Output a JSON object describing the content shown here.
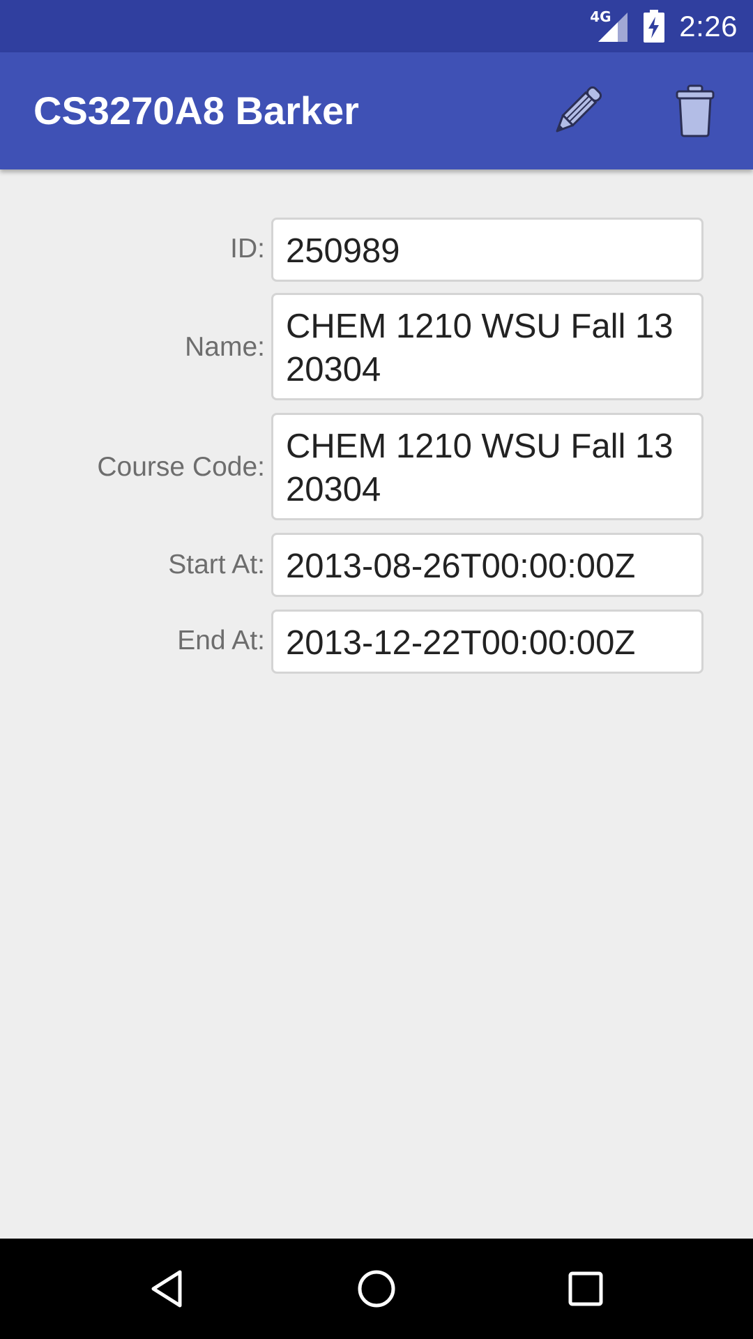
{
  "status_bar": {
    "network_label": "4G",
    "time": "2:26",
    "icons": [
      "signal-icon",
      "battery-charging-icon"
    ]
  },
  "app_bar": {
    "title": "CS3270A8 Barker",
    "actions": [
      {
        "name": "edit",
        "icon": "pencil-icon"
      },
      {
        "name": "delete",
        "icon": "trash-icon"
      }
    ]
  },
  "form": {
    "id": {
      "label": "ID:",
      "value": "250989"
    },
    "name": {
      "label": "Name:",
      "value": "CHEM 1210 WSU Fall 13 20304"
    },
    "course_code": {
      "label": "Course Code:",
      "value": "CHEM 1210 WSU Fall 13 20304"
    },
    "start_at": {
      "label": "Start At:",
      "value": "2013-08-26T00:00:00Z"
    },
    "end_at": {
      "label": "End At:",
      "value": "2013-12-22T00:00:00Z"
    }
  },
  "nav_bar": {
    "buttons": [
      "back-icon",
      "home-icon",
      "recents-icon"
    ]
  },
  "colors": {
    "status_bar": "#303f9f",
    "app_bar": "#3f51b5",
    "background": "#eeeeee",
    "icon_fill": "#b3bde6"
  }
}
